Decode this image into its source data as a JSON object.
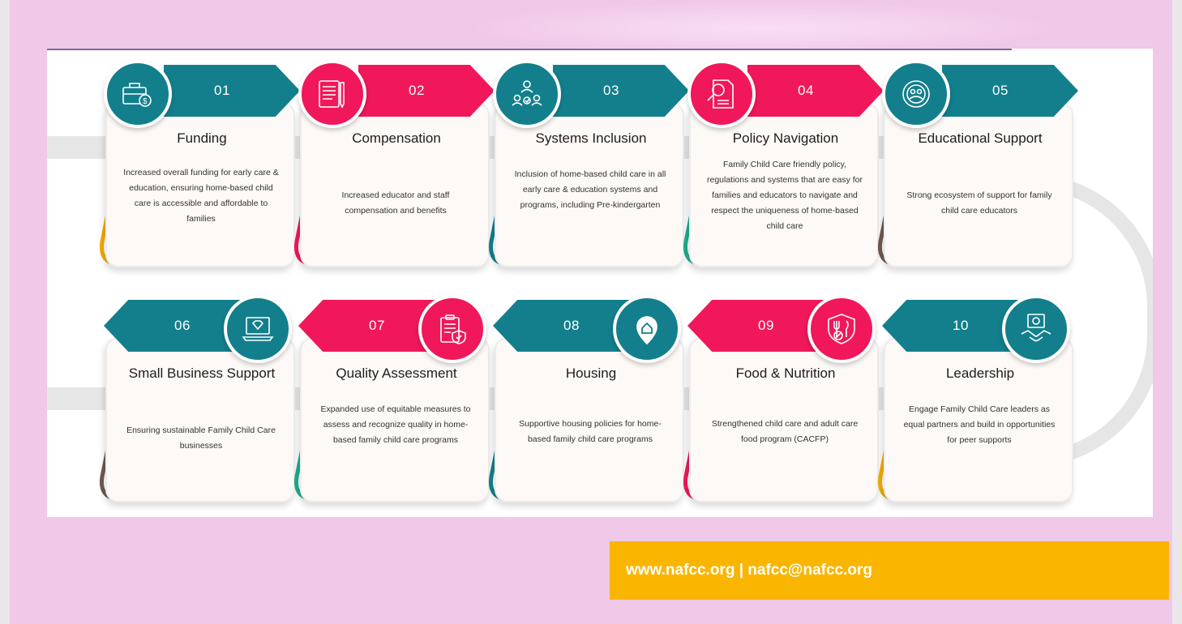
{
  "colors": {
    "teal": "#137f8c",
    "pink": "#f0185a",
    "gold": "#f4ab00",
    "brown": "#6d5a4f",
    "green": "#1dab8a"
  },
  "steps": [
    {
      "number": "01",
      "title": "Funding",
      "desc": "Increased overall funding for early care & education, ensuring home-based child care is accessible and affordable to families",
      "icon": "money-briefcase-icon"
    },
    {
      "number": "02",
      "title": "Compensation",
      "desc": "Increased educator and staff compensation and benefits",
      "icon": "document-pencil-icon"
    },
    {
      "number": "03",
      "title": "Systems Inclusion",
      "desc": "Inclusion of home-based child care in all early care & education systems and programs, including Pre-kindergarten",
      "icon": "people-network-icon"
    },
    {
      "number": "04",
      "title": "Policy Navigation",
      "desc": "Family Child Care friendly policy, regulations and systems that are easy for families and educators to navigate and respect the uniqueness of home-based child care",
      "icon": "document-magnifier-icon"
    },
    {
      "number": "05",
      "title": "Educational Support",
      "desc": "Strong ecosystem of support for family child care educators",
      "icon": "support-circle-icon"
    },
    {
      "number": "06",
      "title": "Small Business Support",
      "desc": "Ensuring sustainable Family Child Care businesses",
      "icon": "laptop-diamond-icon"
    },
    {
      "number": "07",
      "title": "Quality Assessment",
      "desc": "Expanded use of equitable measures to assess and recognize quality in home-based family child care programs",
      "icon": "clipboard-shield-icon"
    },
    {
      "number": "08",
      "title": "Housing",
      "desc": "Supportive housing policies for home-based family child care programs",
      "icon": "house-location-icon"
    },
    {
      "number": "09",
      "title": "Food & Nutrition",
      "desc": "Strengthened child care and adult care food program (CACFP)",
      "icon": "food-utensils-icon"
    },
    {
      "number": "10",
      "title": "Leadership",
      "desc": "Engage Family Child Care leaders as equal partners and build in opportunities for peer supports",
      "icon": "handshake-certificate-icon"
    }
  ],
  "footer": {
    "contact": "www.nafcc.org | nafcc@nafcc.org"
  }
}
